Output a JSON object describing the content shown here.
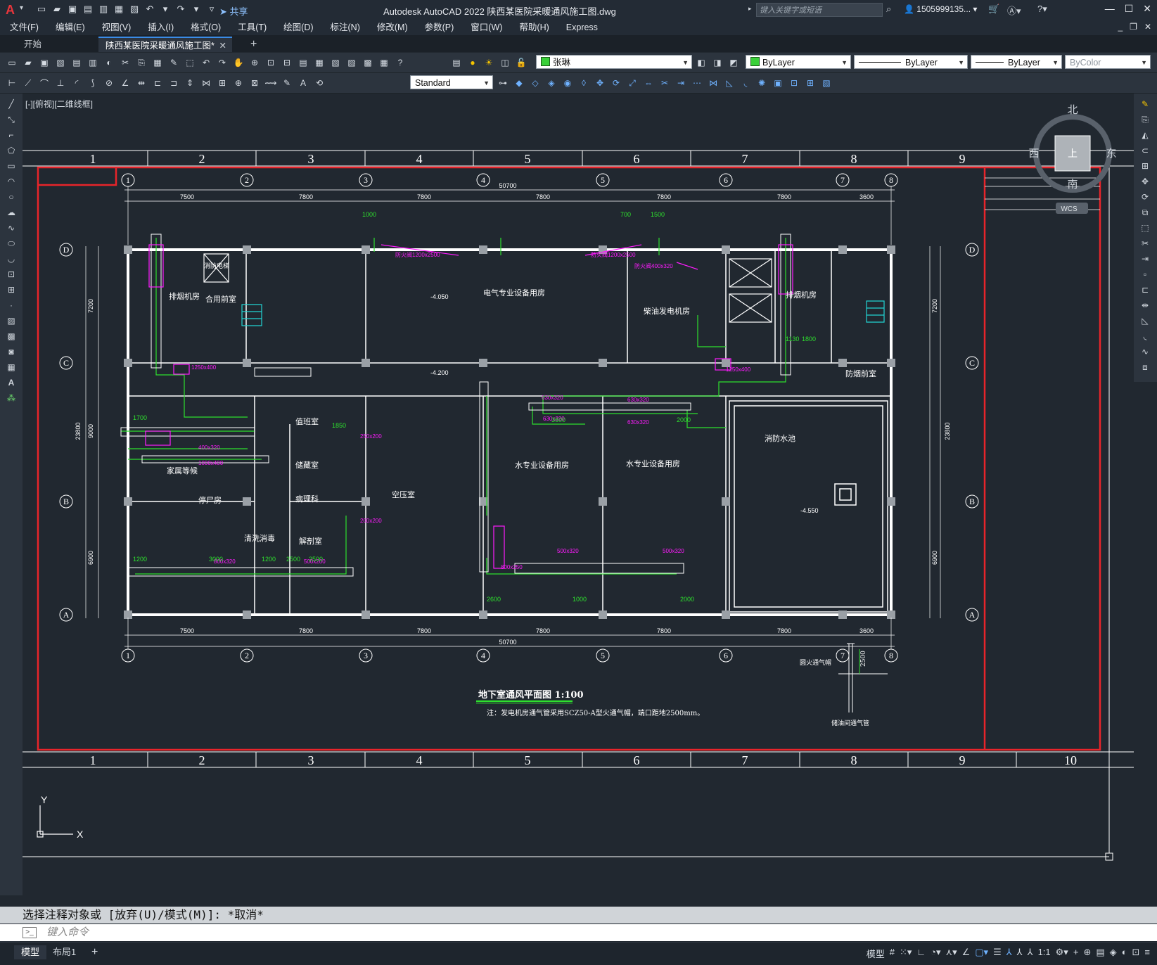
{
  "app": {
    "logo": "A",
    "title": "Autodesk AutoCAD 2022    陕西某医院采暖通风施工图.dwg",
    "share_label": "共享",
    "search_placeholder": "键入关键字或短语",
    "user": "1505999135..."
  },
  "menu": [
    "文件(F)",
    "编辑(E)",
    "视图(V)",
    "插入(I)",
    "格式(O)",
    "工具(T)",
    "绘图(D)",
    "标注(N)",
    "修改(M)",
    "参数(P)",
    "窗口(W)",
    "帮助(H)",
    "Express"
  ],
  "tabs": {
    "start": "开始",
    "document": "陕西某医院采暖通风施工图*",
    "close": "✕",
    "add": "+"
  },
  "toolbar": {
    "layer": "张琳",
    "color": "ByLayer",
    "linetype": "ByLayer",
    "lineweight": "ByLayer",
    "plotstyle": "ByColor",
    "textstyle": "Standard"
  },
  "viewport": {
    "label": "[-][俯视][二维线框]"
  },
  "viewcube": {
    "north": "北",
    "south": "南",
    "east": "东",
    "west": "西",
    "face": "上",
    "wcs": "WCS"
  },
  "drawing": {
    "frame_top_numbers": [
      "1",
      "2",
      "3",
      "4",
      "5",
      "6",
      "7",
      "8",
      "9"
    ],
    "frame_bottom_numbers": [
      "1",
      "2",
      "3",
      "4",
      "5",
      "6",
      "7",
      "8",
      "9",
      "10"
    ],
    "axes": [
      "1",
      "2",
      "3",
      "4",
      "5",
      "6",
      "7",
      "8"
    ],
    "row_axes": [
      "D",
      "C",
      "B",
      "A"
    ],
    "dims_top": [
      "7500",
      "7800",
      "7800",
      "7800",
      "7800",
      "7800",
      "3600"
    ],
    "total_dim": "50700",
    "side_dims": [
      "7200",
      "9000",
      "6900"
    ],
    "total_side_dim": "23800",
    "rooms": {
      "electrical": "电气专业设备用房",
      "diesel": "柴油发电机房",
      "smoke_exhaust_l": "排烟机房",
      "smoke_exhaust_r": "排烟机房",
      "shelter": "合用前室",
      "fire_lift": "消防电梯",
      "water1": "水专业设备用房",
      "water2": "水专业设备用房",
      "fire_pool": "消防水池",
      "pressure": "空压室",
      "family": "家属等候",
      "morgue": "停尸房",
      "duty": "值班室",
      "storage": "储藏室",
      "clean": "清洗消毒",
      "autopsy": "病理科",
      "dissect": "解剖室",
      "anti_smoke": "防烟前室"
    },
    "levels": [
      "-4.050",
      "-4.200",
      "-4.550"
    ],
    "title": "地下室通风平面图 1:100",
    "note": "注：发电机房通气管采用SCZ50-A型火通气帽，端口距地2500mm。",
    "detail_label1": "圆火通气帽",
    "detail_label2": "储油间通气管",
    "detail_dim": "2500"
  },
  "ucs": {
    "x": "X",
    "y": "Y"
  },
  "command": {
    "history": "选择注释对象或 [放弃(U)/模式(M)]: *取消*",
    "placeholder": "键入命令"
  },
  "layouts": {
    "model": "模型",
    "layout1": "布局1",
    "add": "+"
  },
  "status": {
    "model_btn": "模型",
    "scale": "1:1"
  },
  "colors": {
    "accent": "#3a8be6",
    "frame": "#e8242a",
    "duct": "#ff1bff",
    "dim": "#2ee02e",
    "wall": "#ffffff"
  }
}
